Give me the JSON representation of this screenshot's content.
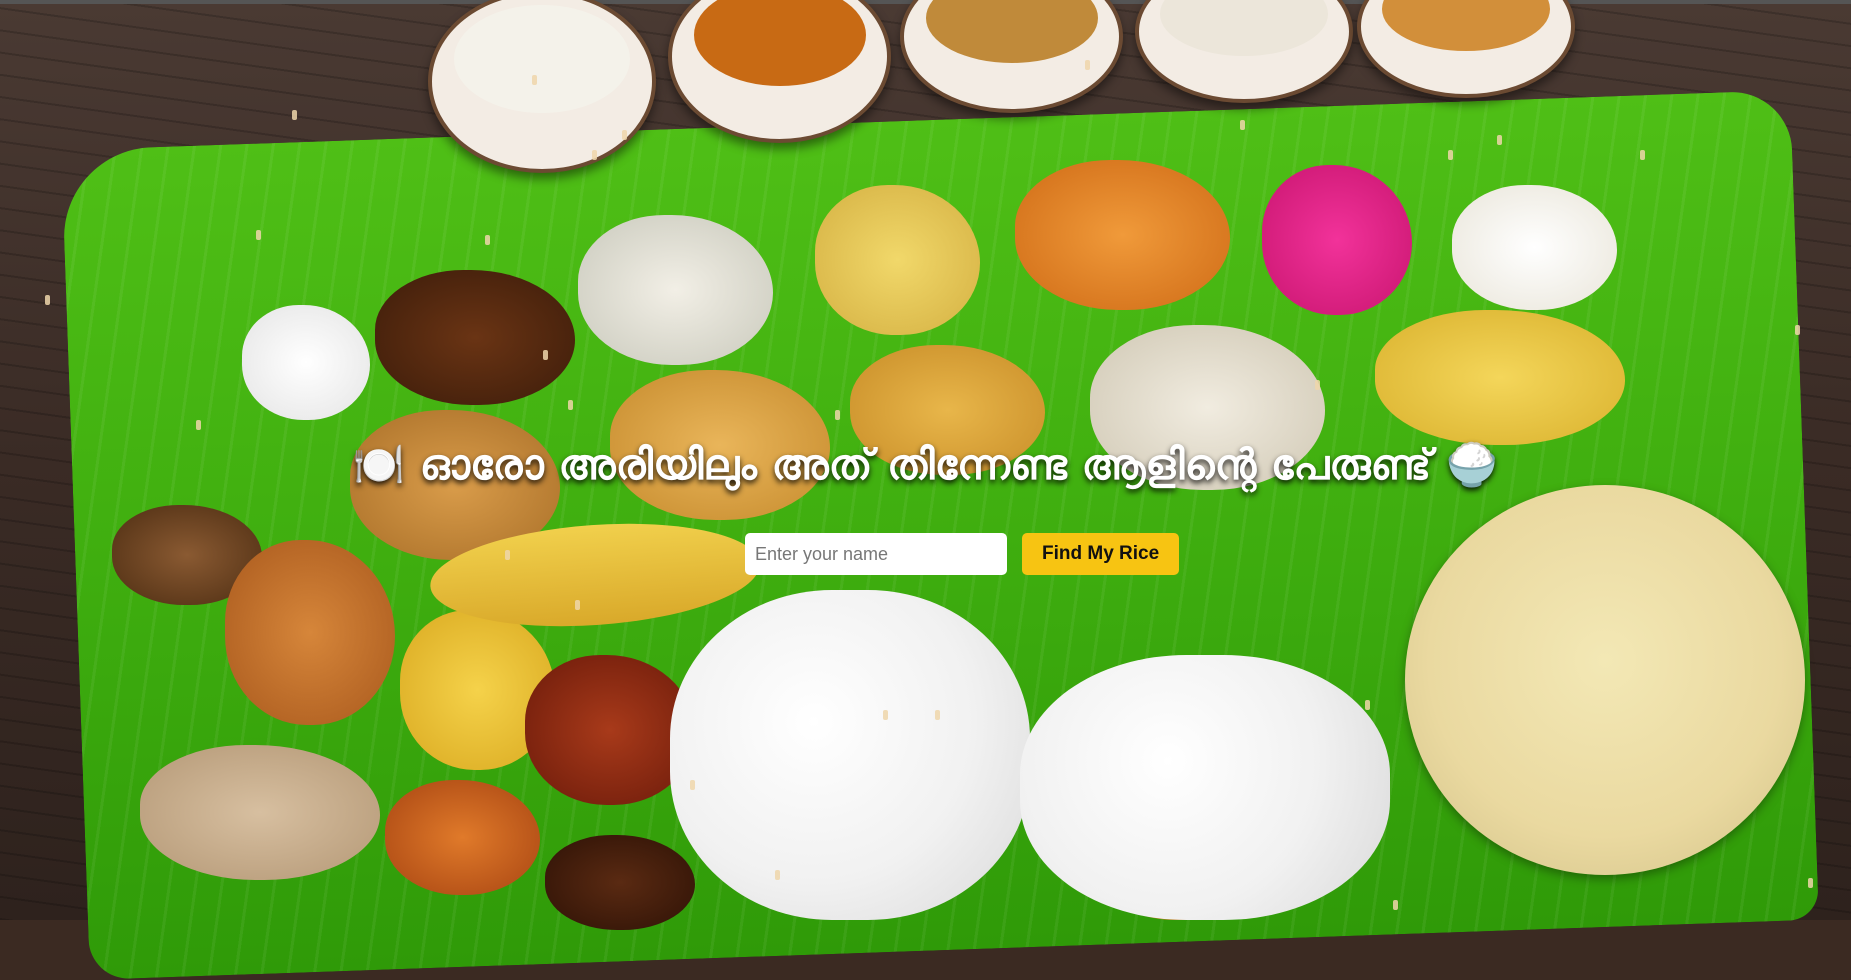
{
  "hero": {
    "headline": "🍽️ ഓരോ അരിയിലും അത് തിന്നേണ്ട ആളിന്റെ പേരുണ്ട് 🍚"
  },
  "form": {
    "name_placeholder": "Enter your name",
    "name_value": "",
    "submit_label": "Find My Rice"
  },
  "colors": {
    "button": "#f7c412",
    "leaf": "#3fae0f",
    "table": "#3a2b25"
  },
  "background": {
    "description_icon": "sadya-feast-photo"
  }
}
